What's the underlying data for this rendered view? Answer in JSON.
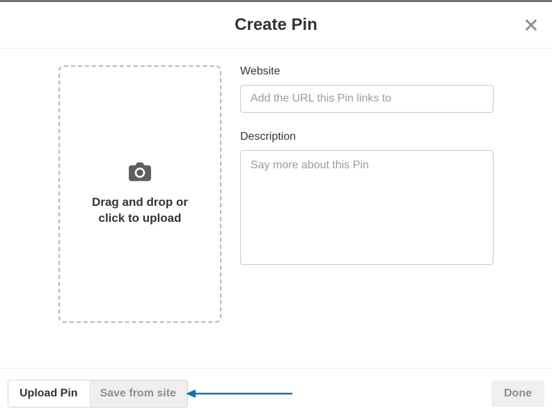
{
  "header": {
    "title": "Create Pin"
  },
  "dropzone": {
    "line1": "Drag and drop or",
    "line2": "click to upload"
  },
  "form": {
    "website_label": "Website",
    "website_placeholder": "Add the URL this Pin links to",
    "description_label": "Description",
    "description_placeholder": "Say more about this Pin"
  },
  "footer": {
    "upload_tab": "Upload Pin",
    "save_tab": "Save from site",
    "done": "Done"
  },
  "annotation": {
    "arrow_color": "#0579a9"
  }
}
